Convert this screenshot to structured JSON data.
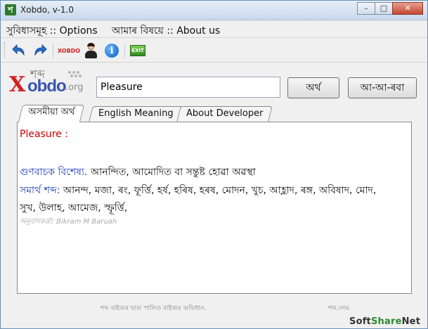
{
  "window": {
    "title": "Xobdo, v-1.0",
    "icon_letter": "শ"
  },
  "window_controls": {
    "minimize": "–",
    "maximize": "□",
    "close": "✕"
  },
  "menu": {
    "options": "সুবিধাসমূহ :: Options",
    "about": "আমাৰ বিষয়ে :: About us"
  },
  "toolbar": {
    "items": [
      "back-arrow-icon",
      "forward-arrow-icon",
      "xobdo-logo-icon",
      "person-icon",
      "info-icon",
      "exit-icon"
    ],
    "logo_icon_text": "XOBDO",
    "info_icon_text": "i",
    "exit_label": "EXIT"
  },
  "logo": {
    "top_text": "শব্দ",
    "main_x": "X",
    "main_rest": "obdo",
    "suffix": ".org"
  },
  "search": {
    "value": "Pleasure"
  },
  "buttons": {
    "meaning": "অৰ্থ",
    "alphabet": "আ-আ-ৰবা"
  },
  "tabs": [
    {
      "label": "অসমীয়া অৰ্থ",
      "active": true
    },
    {
      "label": "English Meaning",
      "active": false
    },
    {
      "label": "About Developer",
      "active": false
    }
  ],
  "result": {
    "word": "Pleasure :",
    "pos_label": "গুণবাচক বিশেষ্য.",
    "definition": " আনন্দিত, আমোদিত বা সন্তুষ্ট হোৱা অৱস্থা",
    "synonyms_label": "সমাৰ্থ শব্দ:",
    "synonyms_line1": " আনন্দ, মজা, ৰং, ফূৰ্ত্তি, হৰ্ষ, হৰিষ, হৰষ, মোদন, খুচ, আহ্লাদ, ৰঙ্গ, অবিষাদ, মোদ,",
    "synonyms_line2": "সুখ, উলাহ, আমেজ, স্ফূৰ্ত্তি,",
    "translator": "অনুবাদকৰ্ত্তা: Bikram M Baruah"
  },
  "footer": {
    "left": "শব্দ ৰাইজৰ দ্বাৰা পালিত ৰাইজৰ অভিধান.",
    "right": "শব্দ.সংঘ"
  },
  "watermark": {
    "soft": "Soft",
    "share": "Share",
    "net": "Net"
  },
  "colors": {
    "accent_red": "#c80000",
    "pos_blue": "#1c3fb5",
    "logo_red": "#d42020",
    "logo_blue": "#3a55b0"
  }
}
